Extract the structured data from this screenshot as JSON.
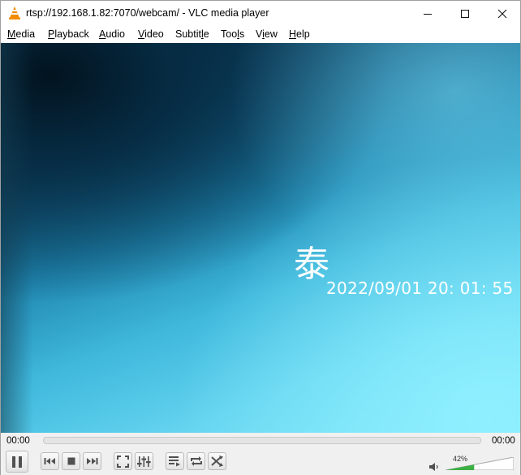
{
  "window": {
    "title": "rtsp://192.168.1.82:7070/webcam/ - VLC media player"
  },
  "menubar": {
    "items": [
      {
        "first": "M",
        "rest": "edia"
      },
      {
        "first": "P",
        "rest": "layback"
      },
      {
        "first": "A",
        "rest": "udio"
      },
      {
        "first": "V",
        "rest": "ideo"
      },
      {
        "first": "",
        "rest": "Subtit",
        "u": "l",
        "tail": "e"
      },
      {
        "first": "",
        "rest": "Too",
        "u": "l",
        "tail": "s"
      },
      {
        "first": "",
        "rest": "V",
        "u": "i",
        "tail": "ew"
      },
      {
        "first": "H",
        "rest": "elp"
      }
    ]
  },
  "video": {
    "osd_char": "泰",
    "osd_timestamp": "2022/09/01  20: 01: 55"
  },
  "controls": {
    "elapsed": "00:00",
    "total": "00:00",
    "volume_percent": "42%",
    "volume_level": 0.42,
    "buttons": [
      "pause",
      "previous",
      "stop",
      "next",
      "fullscreen",
      "extended-settings",
      "playlist",
      "loop",
      "shuffle"
    ]
  },
  "colors": {
    "volume_fill": "#3cb043",
    "button_glyph": "#505050"
  }
}
